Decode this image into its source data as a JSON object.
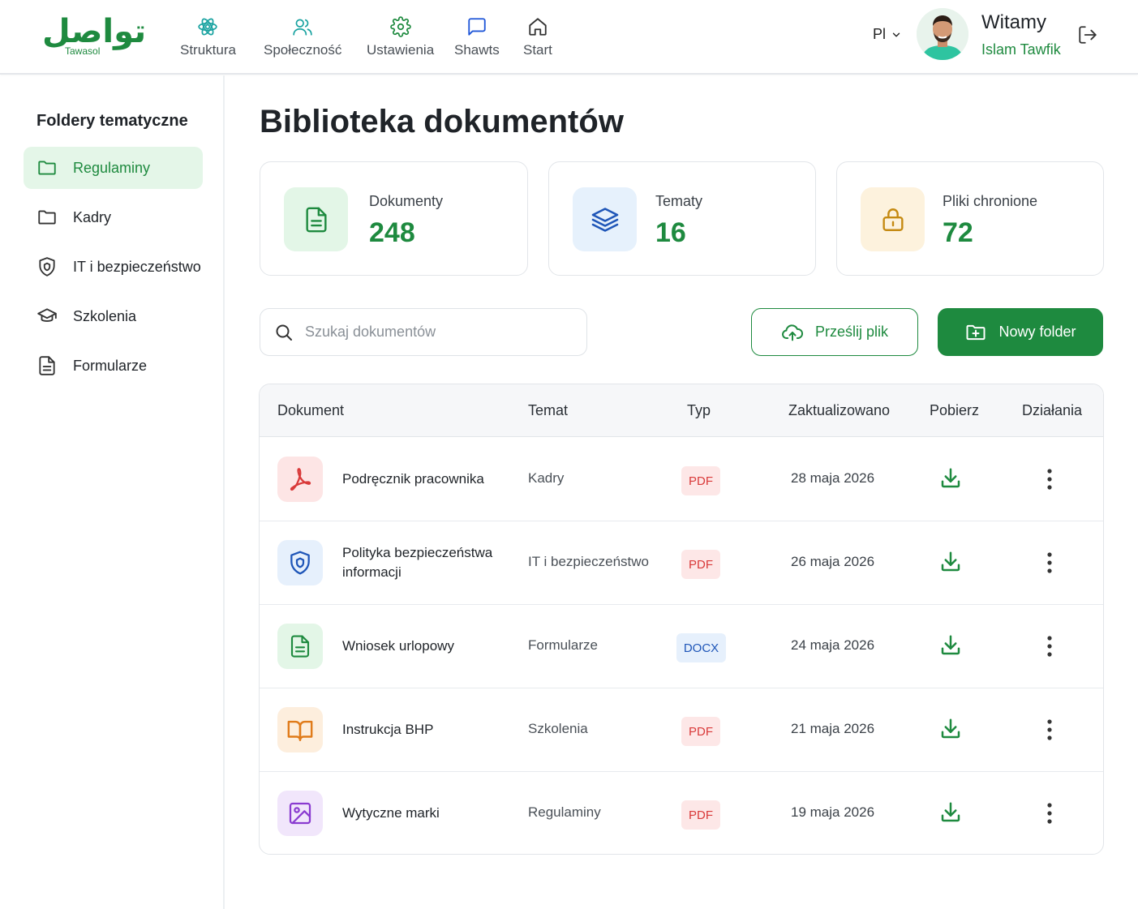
{
  "brand": {
    "logo_arabic": "تواصل",
    "logo_latin": "Tawasol",
    "primary_color": "#1e8a3f"
  },
  "header": {
    "nav": [
      {
        "label": "Struktura",
        "icon": "structure-icon"
      },
      {
        "label": "Społeczność",
        "icon": "users-icon"
      },
      {
        "label": "Ustawienia",
        "icon": "gear-icon"
      },
      {
        "label": "Shawts",
        "icon": "chat-icon"
      },
      {
        "label": "Start",
        "icon": "home-icon"
      }
    ],
    "language": "Pl",
    "welcome": "Witamy",
    "user_name": "Islam Tawfik"
  },
  "sidebar": {
    "title": "Foldery tematyczne",
    "items": [
      {
        "label": "Regulaminy",
        "icon": "folder-icon",
        "active": true
      },
      {
        "label": "Kadry",
        "icon": "folder-icon",
        "active": false
      },
      {
        "label": "IT i bezpieczeństwo",
        "icon": "shield-icon",
        "active": false
      },
      {
        "label": "Szkolenia",
        "icon": "graduation-cap-icon",
        "active": false
      },
      {
        "label": "Formularze",
        "icon": "document-icon",
        "active": false
      }
    ]
  },
  "main": {
    "title": "Biblioteka dokumentów",
    "stats": [
      {
        "label": "Dokumenty",
        "value": "248",
        "icon": "document-icon",
        "color": "#1e8a3f"
      },
      {
        "label": "Tematy",
        "value": "16",
        "icon": "layers-icon",
        "color": "#1f56b8"
      },
      {
        "label": "Pliki chronione",
        "value": "72",
        "icon": "lock-icon",
        "color": "#c58a12"
      }
    ],
    "search": {
      "placeholder": "Szukaj dokumentów",
      "value": ""
    },
    "upload_label": "Prześlij plik",
    "new_folder_label": "Nowy folder"
  },
  "table": {
    "columns": [
      "Dokument",
      "Temat",
      "Typ",
      "Zaktualizowano",
      "Pobierz",
      "Działania"
    ],
    "rows": [
      {
        "name": "Podręcznik pracownika",
        "topic": "Kadry",
        "type": "PDF",
        "updated": "28 maja 2026",
        "icon": "pdf-icon"
      },
      {
        "name": "Polityka bezpieczeństwa informacji",
        "topic": "IT i bezpieczeństwo",
        "type": "PDF",
        "updated": "26 maja 2026",
        "icon": "shield-icon"
      },
      {
        "name": "Wniosek urlopowy",
        "topic": "Formularze",
        "type": "DOCX",
        "updated": "24 maja 2026",
        "icon": "document-icon"
      },
      {
        "name": "Instrukcja BHP",
        "topic": "Szkolenia",
        "type": "PDF",
        "updated": "21 maja 2026",
        "icon": "book-icon"
      },
      {
        "name": "Wytyczne marki",
        "topic": "Regulaminy",
        "type": "PDF",
        "updated": "19 maja 2026",
        "icon": "image-icon"
      }
    ]
  }
}
